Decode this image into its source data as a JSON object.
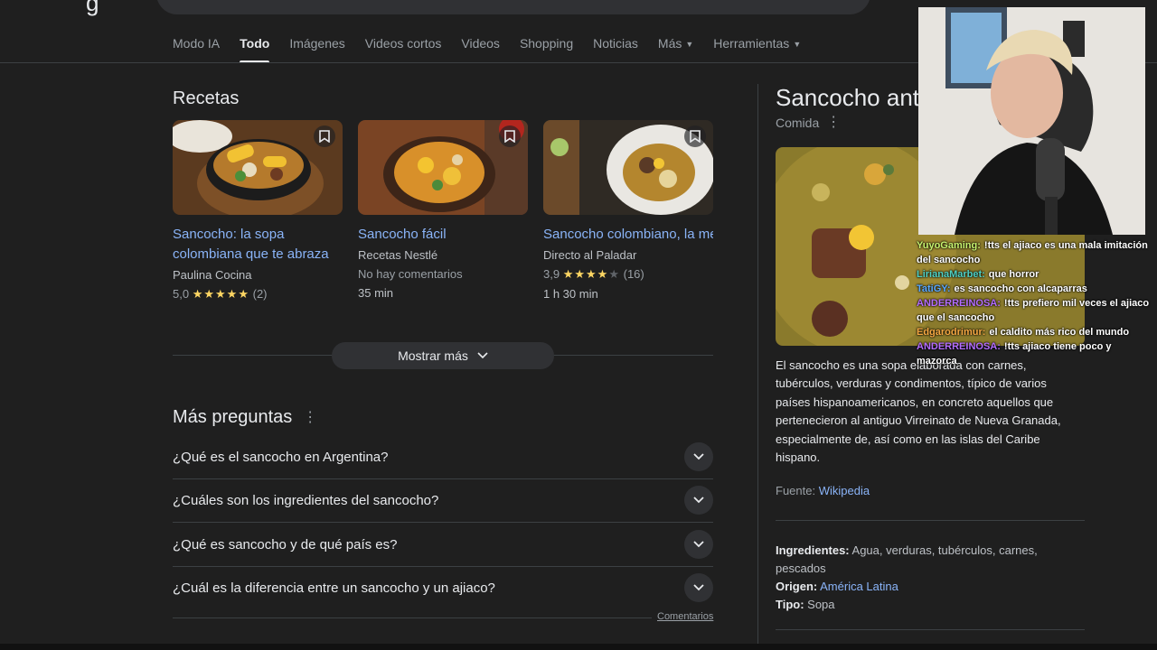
{
  "tabs": [
    {
      "label": "Modo IA",
      "active": false
    },
    {
      "label": "Todo",
      "active": true
    },
    {
      "label": "Imágenes",
      "active": false
    },
    {
      "label": "Videos cortos",
      "active": false
    },
    {
      "label": "Videos",
      "active": false
    },
    {
      "label": "Shopping",
      "active": false
    },
    {
      "label": "Noticias",
      "active": false
    },
    {
      "label": "Más",
      "active": false,
      "dropdown": true
    },
    {
      "label": "Herramientas",
      "active": false,
      "dropdown": true
    }
  ],
  "recipes": {
    "title": "Recetas",
    "items": [
      {
        "title": "Sancocho: la sopa colombiana que te abraza",
        "source": "Paulina Cocina",
        "rating": "5,0",
        "stars": 5,
        "count": "(2)",
        "time": ""
      },
      {
        "title": "Sancocho fácil",
        "source": "Recetas Nestlé",
        "comments": "No hay comentarios",
        "time": "35 min"
      },
      {
        "title": "Sancocho colombiano, la mejor receta de esta sop...",
        "source": "Directo al Paladar",
        "rating": "3,9",
        "stars": 4,
        "count": "(16)",
        "time": "1 h 30 min"
      }
    ],
    "more_label": "Mostrar más"
  },
  "questions": {
    "title": "Más preguntas",
    "items": [
      "¿Qué es el sancocho en Argentina?",
      "¿Cuáles son los ingredientes del sancocho?",
      "¿Qué es sancocho y de qué país es?",
      "¿Cuál es la diferencia entre un sancocho y un ajiaco?"
    ],
    "feedback": "Comentarios"
  },
  "knowledge_panel": {
    "title": "Sancocho ant",
    "subtitle": "Comida",
    "description": "El sancocho es una sopa elaborada con carnes, tubérculos, verduras y condimentos, típico de varios países hispanoamericanos, en concreto aquellos que pertenecieron al antiguo Virreinato de Nueva Granada, especialmente de, así como en las islas del Caribe hispano.",
    "source_label": "Fuente:",
    "source_link": "Wikipedia",
    "facts": {
      "ingredients_label": "Ingredientes:",
      "ingredients_value": "Agua, verduras, tubérculos, carnes, pescados",
      "origin_label": "Origen:",
      "origin_value": "América Latina",
      "type_label": "Tipo:",
      "type_value": "Sopa"
    }
  },
  "chat": [
    {
      "user": "YuyoGaming:",
      "color": "#c6f26e",
      "msg": "!tts el ajiaco es una mala imitación del sancocho"
    },
    {
      "user": "LirianaMarbet:",
      "color": "#4fd1c5",
      "msg": "que horror"
    },
    {
      "user": "TatiGY:",
      "color": "#5aa9ff",
      "msg": "es sancocho con alcaparras"
    },
    {
      "user": "ANDERREINOSA:",
      "color": "#b46dff",
      "msg": "!tts prefiero mil veces el ajiaco que el sancocho"
    },
    {
      "user": "Edgarodrimur:",
      "color": "#f5a742",
      "msg": "el caldito más rico del mundo"
    },
    {
      "user": "ANDERREINOSA:",
      "color": "#b46dff",
      "msg": "!tts ajiaco tiene poco y mazorca"
    }
  ],
  "colors": {
    "link": "#8ab4f8",
    "star": "#fdd663",
    "bg": "#1f1f1f"
  }
}
